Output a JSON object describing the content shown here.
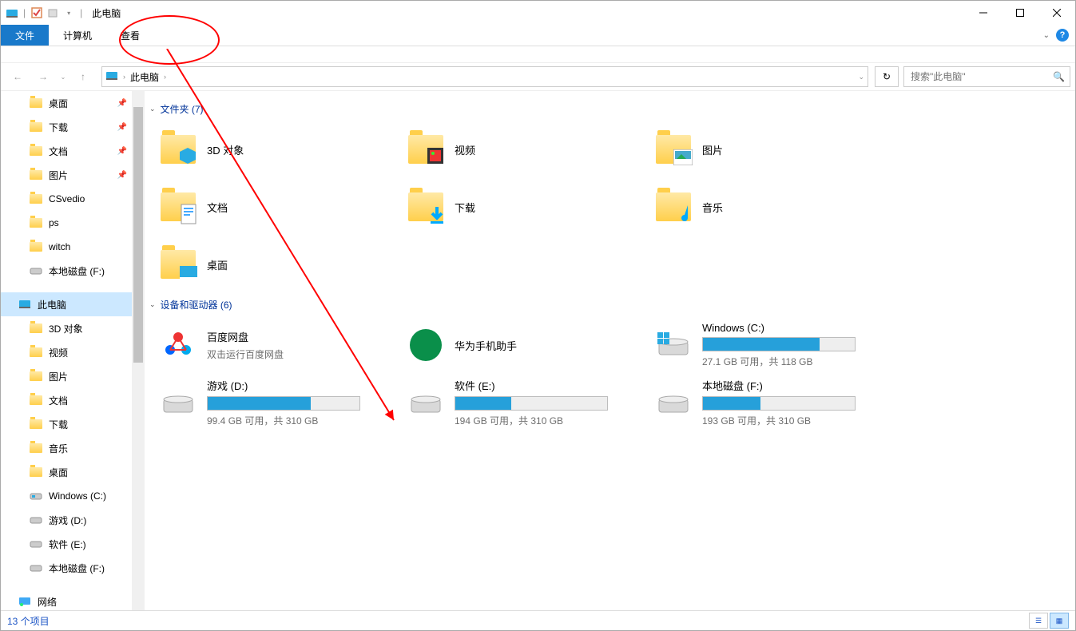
{
  "title": "此电脑",
  "ribbon": {
    "file": "文件",
    "computer": "计算机",
    "view": "查看"
  },
  "addr": {
    "crumb": "此电脑",
    "drop": "›"
  },
  "search": {
    "placeholder": "搜索\"此电脑\""
  },
  "sidebar": [
    {
      "kind": "f",
      "label": "桌面",
      "pin": true
    },
    {
      "kind": "f",
      "label": "下载",
      "pin": true
    },
    {
      "kind": "f",
      "label": "文档",
      "pin": true
    },
    {
      "kind": "f",
      "label": "图片",
      "pin": true
    },
    {
      "kind": "f",
      "label": "CSvedio"
    },
    {
      "kind": "f",
      "label": "ps"
    },
    {
      "kind": "f",
      "label": "witch"
    },
    {
      "kind": "d",
      "label": "本地磁盘 (F:)"
    },
    {
      "kind": "blank"
    },
    {
      "kind": "pc",
      "label": "此电脑",
      "selected": true,
      "lvl0": true
    },
    {
      "kind": "f",
      "label": "3D 对象"
    },
    {
      "kind": "f",
      "label": "视频"
    },
    {
      "kind": "f",
      "label": "图片"
    },
    {
      "kind": "f",
      "label": "文档"
    },
    {
      "kind": "f",
      "label": "下载"
    },
    {
      "kind": "f",
      "label": "音乐"
    },
    {
      "kind": "f",
      "label": "桌面"
    },
    {
      "kind": "d",
      "label": "Windows (C:)",
      "win": true
    },
    {
      "kind": "d",
      "label": "游戏 (D:)"
    },
    {
      "kind": "d",
      "label": "软件 (E:)"
    },
    {
      "kind": "d",
      "label": "本地磁盘 (F:)"
    },
    {
      "kind": "blank"
    },
    {
      "kind": "net",
      "label": "网络",
      "lvl0": true
    }
  ],
  "groups": [
    {
      "header": "文件夹 (7)",
      "type": "folders",
      "items": [
        {
          "label": "3D 对象",
          "deco": "cube"
        },
        {
          "label": "视频",
          "deco": "video"
        },
        {
          "label": "图片",
          "deco": "pic"
        },
        {
          "label": "文档",
          "deco": "doc"
        },
        {
          "label": "下载",
          "deco": "dl"
        },
        {
          "label": "音乐",
          "deco": "music"
        },
        {
          "label": "桌面",
          "deco": "desk"
        }
      ]
    },
    {
      "header": "设备和驱动器 (6)",
      "type": "drives",
      "items": [
        {
          "label": "百度网盘",
          "sub": "双击运行百度网盘",
          "app": "baidu"
        },
        {
          "label": "华为手机助手",
          "app": "huawei"
        },
        {
          "label": "Windows (C:)",
          "free": "27.1 GB 可用，共 118 GB",
          "pct": 77,
          "win": true
        },
        {
          "label": "游戏 (D:)",
          "free": "99.4 GB 可用，共 310 GB",
          "pct": 68
        },
        {
          "label": "软件 (E:)",
          "free": "194 GB 可用，共 310 GB",
          "pct": 37
        },
        {
          "label": "本地磁盘 (F:)",
          "free": "193 GB 可用，共 310 GB",
          "pct": 38
        }
      ]
    }
  ],
  "status": "13 个项目"
}
